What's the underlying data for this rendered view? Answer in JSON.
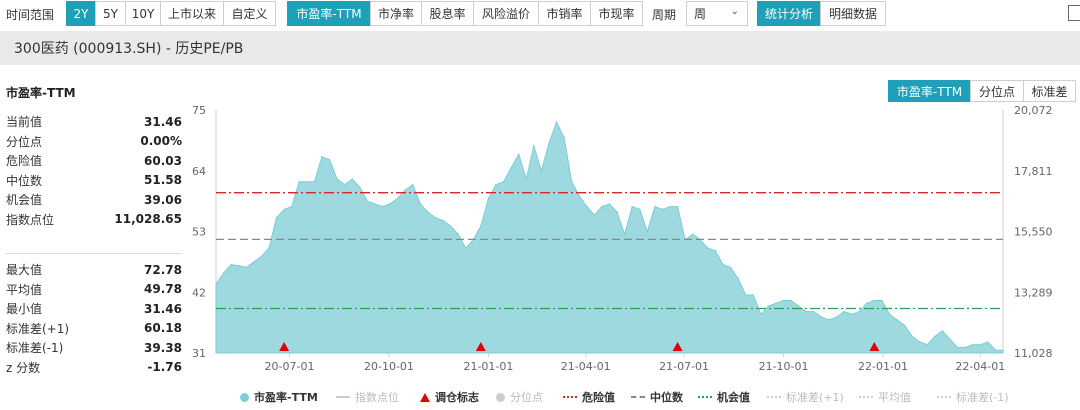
{
  "toolbar": {
    "time_range_label": "时间范围",
    "time_ranges": [
      "2Y",
      "5Y",
      "10Y",
      "上市以来",
      "自定义"
    ],
    "metrics": [
      "市盈率-TTM",
      "市净率",
      "股息率",
      "风险溢价",
      "市销率",
      "市现率"
    ],
    "period_label": "周期",
    "period_value": "周",
    "views": [
      "统计分析",
      "明细数据"
    ]
  },
  "page_title": "300医药 (000913.SH) - 历史PE/PB",
  "panel_title": "市盈率-TTM",
  "stats_current": [
    {
      "label": "当前值",
      "value": "31.46"
    },
    {
      "label": "分位点",
      "value": "0.00%"
    },
    {
      "label": "危险值",
      "value": "60.03"
    },
    {
      "label": "中位数",
      "value": "51.58"
    },
    {
      "label": "机会值",
      "value": "39.06"
    },
    {
      "label": "指数点位",
      "value": "11,028.65"
    }
  ],
  "stats_summary": [
    {
      "label": "最大值",
      "value": "72.78"
    },
    {
      "label": "平均值",
      "value": "49.78"
    },
    {
      "label": "最小值",
      "value": "31.46"
    },
    {
      "label": "标准差(+1)",
      "value": "60.18"
    },
    {
      "label": "标准差(-1)",
      "value": "39.38"
    },
    {
      "label": "z 分数",
      "value": "-1.76"
    }
  ],
  "chart_tabs": [
    "市盈率-TTM",
    "分位点",
    "标准差"
  ],
  "colors": {
    "accent": "#1ea0b8",
    "area_fill": "#9fd9e0",
    "area_line": "#7ccdd7",
    "danger": "#d62728",
    "median": "#888888",
    "opportunity": "#2ca05a",
    "signal": "#e00000"
  },
  "chart_data": {
    "type": "area",
    "series": [
      {
        "name": "市盈率-TTM",
        "x": [
          "2020-04-24",
          "2020-05-01",
          "2020-05-08",
          "2020-05-15",
          "2020-05-22",
          "2020-05-29",
          "2020-06-05",
          "2020-06-12",
          "2020-06-19",
          "2020-06-26",
          "2020-07-03",
          "2020-07-10",
          "2020-07-17",
          "2020-07-24",
          "2020-07-31",
          "2020-08-07",
          "2020-08-14",
          "2020-08-21",
          "2020-08-28",
          "2020-09-04",
          "2020-09-11",
          "2020-09-18",
          "2020-09-25",
          "2020-10-02",
          "2020-10-09",
          "2020-10-16",
          "2020-10-23",
          "2020-10-30",
          "2020-11-06",
          "2020-11-13",
          "2020-11-20",
          "2020-11-27",
          "2020-12-04",
          "2020-12-11",
          "2020-12-18",
          "2020-12-25",
          "2021-01-01",
          "2021-01-08",
          "2021-01-15",
          "2021-01-22",
          "2021-01-29",
          "2021-02-05",
          "2021-02-12",
          "2021-02-19",
          "2021-02-26",
          "2021-03-05",
          "2021-03-12",
          "2021-03-19",
          "2021-03-26",
          "2021-04-02",
          "2021-04-09",
          "2021-04-16",
          "2021-04-23",
          "2021-04-30",
          "2021-05-07",
          "2021-05-14",
          "2021-05-21",
          "2021-05-28",
          "2021-06-04",
          "2021-06-11",
          "2021-06-18",
          "2021-06-25",
          "2021-07-02",
          "2021-07-09",
          "2021-07-16",
          "2021-07-23",
          "2021-07-30",
          "2021-08-06",
          "2021-08-13",
          "2021-08-20",
          "2021-08-27",
          "2021-09-03",
          "2021-09-10",
          "2021-09-17",
          "2021-09-24",
          "2021-10-01",
          "2021-10-08",
          "2021-10-15",
          "2021-10-22",
          "2021-10-29",
          "2021-11-05",
          "2021-11-12",
          "2021-11-19",
          "2021-11-26",
          "2021-12-03",
          "2021-12-10",
          "2021-12-17",
          "2021-12-24",
          "2021-12-31",
          "2022-01-07",
          "2022-01-14",
          "2022-01-21",
          "2022-01-28",
          "2022-02-04",
          "2022-02-11",
          "2022-02-18",
          "2022-02-25",
          "2022-03-04",
          "2022-03-11",
          "2022-03-18",
          "2022-03-25",
          "2022-04-01",
          "2022-04-08",
          "2022-04-15",
          "2022-04-22"
        ],
        "values": [
          43.5,
          45.5,
          47.0,
          46.8,
          46.5,
          47.5,
          48.5,
          50.0,
          55.5,
          57.0,
          57.5,
          62.0,
          62.0,
          62.0,
          66.5,
          66.0,
          62.5,
          61.5,
          62.5,
          61.0,
          58.5,
          58.0,
          57.5,
          58.0,
          59.0,
          60.5,
          61.5,
          58.0,
          56.5,
          55.5,
          55.0,
          54.0,
          52.5,
          50.0,
          51.5,
          54.0,
          59.0,
          61.5,
          62.0,
          64.5,
          67.0,
          62.5,
          68.5,
          64.0,
          69.0,
          72.8,
          70.0,
          62.0,
          59.5,
          57.5,
          56.0,
          57.5,
          58.0,
          56.5,
          52.5,
          57.5,
          57.0,
          53.0,
          57.5,
          57.0,
          57.5,
          57.5,
          51.5,
          52.5,
          51.5,
          50.0,
          49.5,
          47.0,
          46.5,
          44.5,
          41.5,
          41.5,
          38.0,
          39.5,
          40.0,
          40.5,
          40.5,
          39.5,
          38.5,
          38.5,
          37.5,
          37.0,
          37.5,
          38.5,
          38.0,
          38.5,
          40.0,
          40.5,
          40.5,
          38.0,
          37.0,
          36.0,
          34.0,
          33.0,
          32.5,
          34.0,
          35.0,
          33.5,
          32.0,
          32.0,
          32.5,
          32.5,
          33.0,
          31.5,
          31.5
        ]
      }
    ],
    "reference_lines": [
      {
        "name": "危险值",
        "value": 60.03
      },
      {
        "name": "中位数",
        "value": 51.58
      },
      {
        "name": "机会值",
        "value": 39.06
      }
    ],
    "signals": {
      "name": "调仓标志",
      "x": [
        "2020-06-26",
        "2020-12-25",
        "2021-06-25",
        "2021-12-24"
      ]
    },
    "xticks": [
      "20-07-01",
      "20-10-01",
      "21-01-01",
      "21-04-01",
      "21-07-01",
      "21-10-01",
      "22-01-01",
      "22-04-01"
    ],
    "yticks_left": [
      "75",
      "64",
      "53",
      "42",
      "31"
    ],
    "ylim_left": [
      31,
      75
    ],
    "yticks_right": [
      "20,072",
      "17,811",
      "15,550",
      "13,289",
      "11,028"
    ],
    "legend_items": [
      {
        "label": "市盈率-TTM",
        "type": "dot",
        "color": "#7ccdd7"
      },
      {
        "label": "指数点位",
        "type": "line",
        "color": "#cccccc"
      },
      {
        "label": "调仓标志",
        "type": "triangle",
        "color": "#e00000"
      },
      {
        "label": "分位点",
        "type": "dot",
        "color": "#cccccc"
      },
      {
        "label": "危险值",
        "type": "dashdot",
        "color": "#d62728"
      },
      {
        "label": "中位数",
        "type": "dash",
        "color": "#888888"
      },
      {
        "label": "机会值",
        "type": "dashdot",
        "color": "#2ca05a"
      },
      {
        "label": "标准差(+1)",
        "type": "dashdot",
        "color": "#cccccc"
      },
      {
        "label": "平均值",
        "type": "dashdot",
        "color": "#cccccc"
      },
      {
        "label": "标准差(-1)",
        "type": "dashdot",
        "color": "#cccccc"
      }
    ],
    "grid": false,
    "legend_position": "bottom"
  }
}
